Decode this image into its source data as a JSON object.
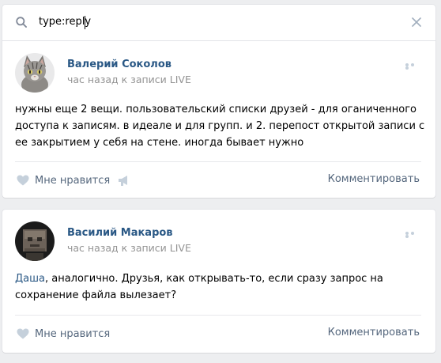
{
  "search": {
    "query": "type:reply",
    "icon": "search-icon",
    "clear_icon": "close-icon"
  },
  "posts": [
    {
      "author": "Валерий Соколов",
      "meta": "час назад к записи LIVE",
      "text": "нужны еще 2 вещи. пользовательский списки друзей - для оганиченного доступа к записям. в идеале и для групп. и 2. перепост открытой записи с ее закрытием у себя на стене. иногда бывает нужно",
      "avatar": "cat-avatar",
      "like_label": "Мне нравится",
      "comment_label": "Комментировать"
    },
    {
      "author": "Василий Макаров",
      "meta": "час назад к записи LIVE",
      "mention": "Даша",
      "text": ", аналогично. Друзья, как открывать-то, если сразу запрос на сохранение файла вылезает?",
      "avatar": "block-avatar",
      "like_label": "Мне нравится",
      "comment_label": "Комментировать"
    }
  ],
  "colors": {
    "background": "#edeef0",
    "link": "#2a5885",
    "meta": "#939393",
    "action": "#55677d",
    "icon": "#c5d0db"
  }
}
